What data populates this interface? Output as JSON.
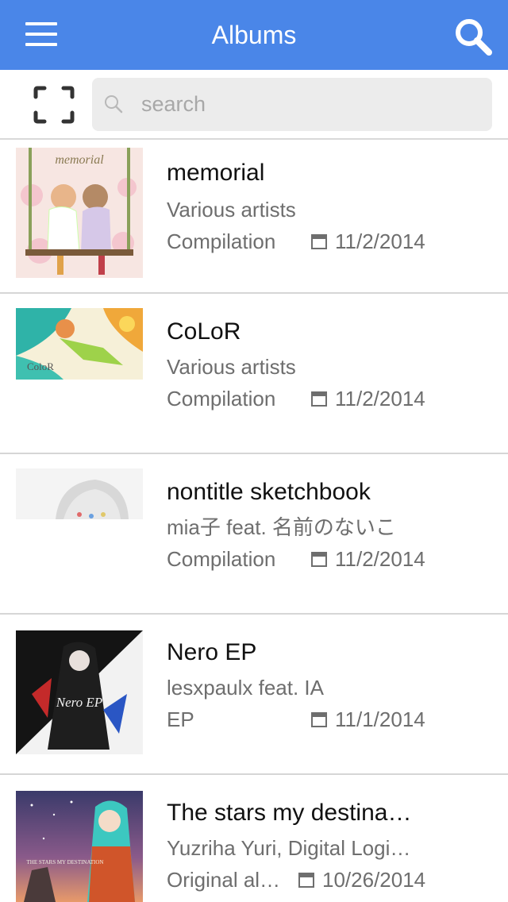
{
  "navbar": {
    "title": "Albums",
    "menu_icon": "hamburger-menu-icon",
    "search_icon": "search-icon"
  },
  "searchbar": {
    "scan_icon": "scan-frame-icon",
    "placeholder": "search",
    "value": ""
  },
  "albums": [
    {
      "title": "memorial",
      "artist": "Various artists",
      "type": "Compilation",
      "date": "11/2/2014"
    },
    {
      "title": "CoLoR",
      "artist": "Various artists",
      "type": "Compilation",
      "date": "11/2/2014"
    },
    {
      "title": "nontitle sketchbook",
      "artist": "mia子 feat. 名前のないこ",
      "type": "Compilation",
      "date": "11/2/2014"
    },
    {
      "title": "Nero EP",
      "artist": "lesxpaulx feat. IA",
      "type": "EP",
      "date": "11/1/2014"
    },
    {
      "title": "The stars my destina…",
      "artist": "Yuzriha Yuri, Digital Logi…",
      "type": "Original al…",
      "date": "10/26/2014"
    }
  ],
  "cover_text": {
    "memorial": "memorial",
    "color": "ColoR",
    "nero": "Nero EP",
    "stars": "THE STARS MY DESTINATION"
  },
  "colors": {
    "accent": "#4a86e8",
    "title_text": "#111111",
    "secondary_text": "#6e6e6e",
    "divider": "#d6d6d6",
    "search_field": "#ececec"
  }
}
